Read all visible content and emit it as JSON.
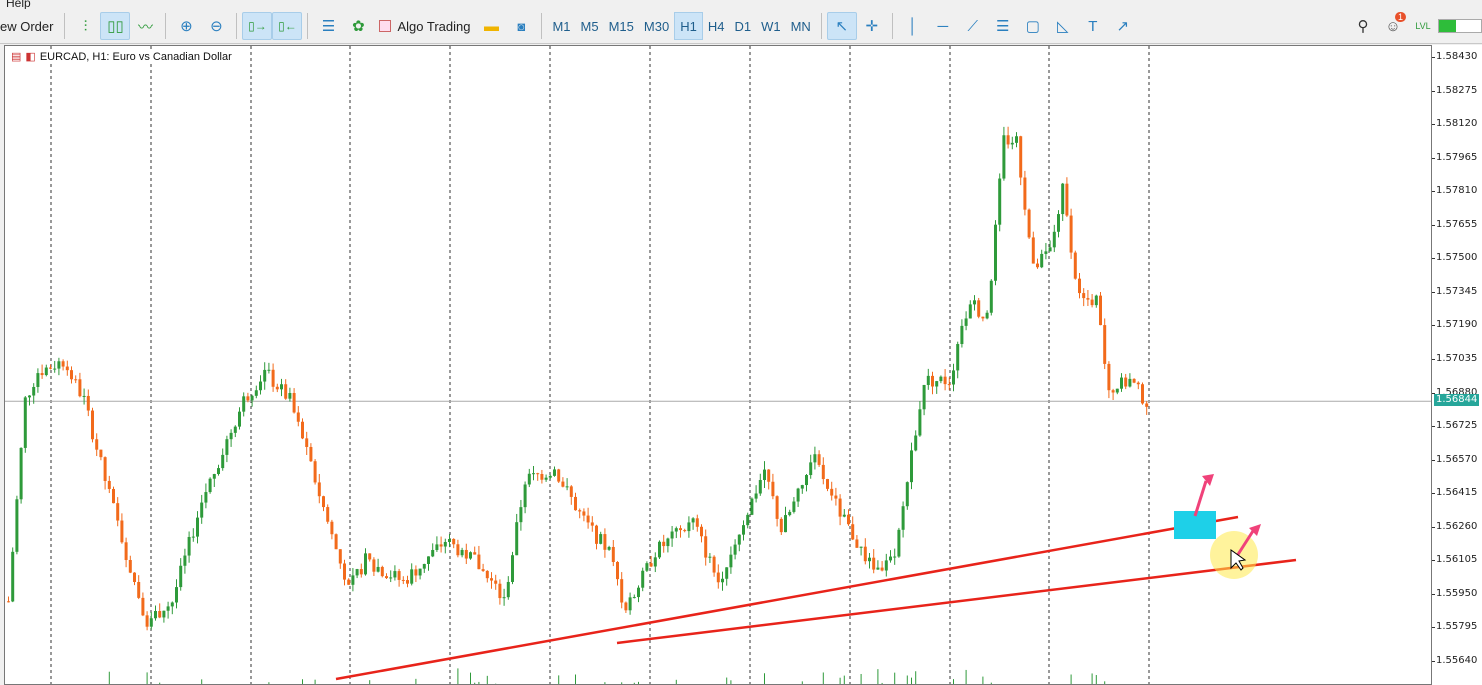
{
  "menu": {
    "help": "Help"
  },
  "toolbar": {
    "new_order": "ew Order",
    "algo_trading": "Algo Trading",
    "timeframes": [
      "M1",
      "M5",
      "M15",
      "M30",
      "H1",
      "H4",
      "D1",
      "W1",
      "MN"
    ],
    "active_timeframe": "H1",
    "notification_count": "1",
    "lvl": "LVL"
  },
  "chart": {
    "symbol_title": "EURCAD, H1:  Euro vs Canadian Dollar",
    "current_price": "1.56844",
    "price_ticks": [
      "1.58430",
      "1.58275",
      "1.58120",
      "1.57965",
      "1.57810",
      "1.57655",
      "1.57500",
      "1.57345",
      "1.57190",
      "1.57035",
      "1.56880",
      "1.56725",
      "1.56570",
      "1.56415",
      "1.56260",
      "1.56105",
      "1.55950",
      "1.55795",
      "1.55640"
    ],
    "colors": {
      "bull": "#2e9a3a",
      "bear": "#f26a1b",
      "trendline": "#e8231a",
      "rectangle": "#1ed0e8",
      "arrow": "#f0427a"
    },
    "price_path": [
      [
        0,
        1.5592
      ],
      [
        4,
        1.5685
      ],
      [
        7,
        1.5698
      ],
      [
        13,
        1.5703
      ],
      [
        18,
        1.5685
      ],
      [
        23,
        1.5648
      ],
      [
        30,
        1.5601
      ],
      [
        33,
        1.5583
      ],
      [
        39,
        1.5592
      ],
      [
        46,
        1.5638
      ],
      [
        56,
        1.5685
      ],
      [
        61,
        1.5698
      ],
      [
        67,
        1.5685
      ],
      [
        73,
        1.5648
      ],
      [
        81,
        1.5597
      ],
      [
        85,
        1.5611
      ],
      [
        94,
        1.5601
      ],
      [
        104,
        1.562
      ],
      [
        111,
        1.5611
      ],
      [
        118,
        1.5592
      ],
      [
        123,
        1.5648
      ],
      [
        130,
        1.5653
      ],
      [
        137,
        1.5629
      ],
      [
        143,
        1.5615
      ],
      [
        147,
        1.5587
      ],
      [
        154,
        1.5615
      ],
      [
        163,
        1.5629
      ],
      [
        169,
        1.5601
      ],
      [
        175,
        1.5629
      ],
      [
        180,
        1.5653
      ],
      [
        184,
        1.5625
      ],
      [
        192,
        1.5657
      ],
      [
        199,
        1.5629
      ],
      [
        206,
        1.5606
      ],
      [
        211,
        1.5611
      ],
      [
        214,
        1.5648
      ],
      [
        218,
        1.5694
      ],
      [
        224,
        1.5694
      ],
      [
        229,
        1.5731
      ],
      [
        233,
        1.5722
      ],
      [
        237,
        1.5805
      ],
      [
        240,
        1.5805
      ],
      [
        244,
        1.5745
      ],
      [
        248,
        1.5754
      ],
      [
        251,
        1.5782
      ],
      [
        255,
        1.5731
      ],
      [
        259,
        1.5731
      ],
      [
        262,
        1.5689
      ],
      [
        267,
        1.5694
      ],
      [
        271,
        1.5684
      ]
    ]
  }
}
